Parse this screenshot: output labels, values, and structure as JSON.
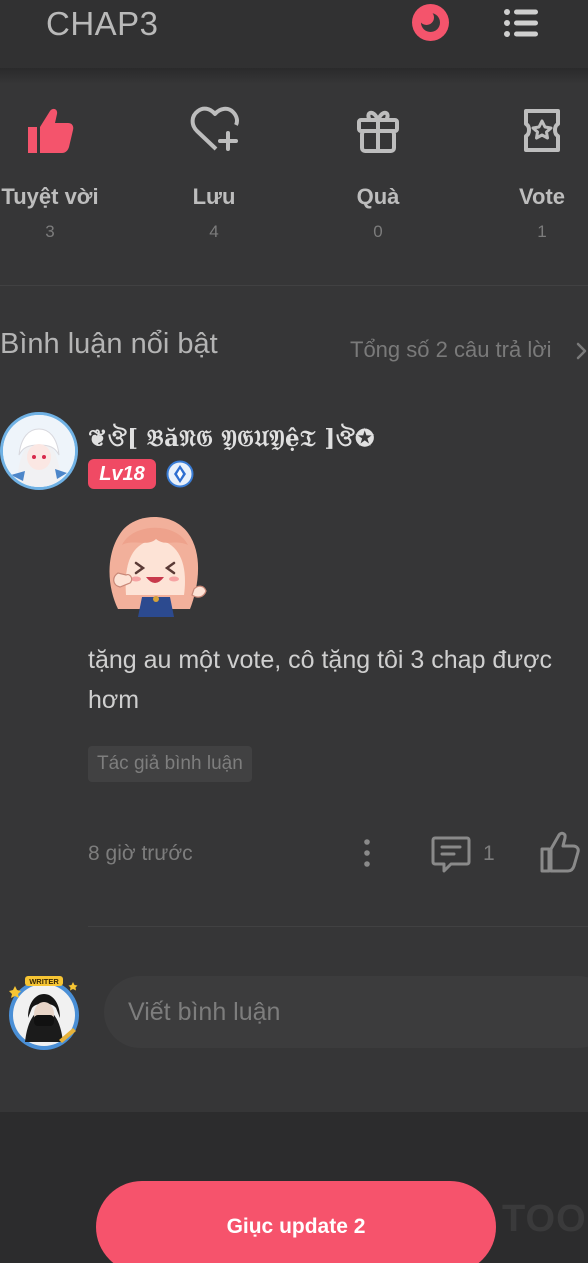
{
  "header": {
    "title": "CHAP3",
    "theme_icon": "moon-eye-icon",
    "menu_icon": "list-menu-icon"
  },
  "reactions": [
    {
      "label": "Tuyệt vời",
      "count": "3",
      "icon": "thumbs-up-icon",
      "color": "#f4546c"
    },
    {
      "label": "Lưu",
      "count": "4",
      "icon": "heart-plus-icon"
    },
    {
      "label": "Quà",
      "count": "0",
      "icon": "gift-icon"
    },
    {
      "label": "Vote",
      "count": "1",
      "icon": "star-ticket-icon"
    }
  ],
  "comments_section": {
    "title": "Bình luận nổi bật",
    "total": "Tổng số 2 câu trả lời"
  },
  "comment": {
    "username": "❦ঔ[ 𝔅ă𝔑𝔊 𝔜𝔊𝔘𝔜ệ𝔗 ]ঔ✪",
    "level": "Lv18",
    "text": "tặng au một vote, cô tặng tôi 3 chap được hơm",
    "tag": "Tác giả bình luận",
    "time": "8 giờ trước",
    "reply_count": "1"
  },
  "input": {
    "placeholder": "Viết bình luận",
    "avatar_badge": "WRITER"
  },
  "footer": {
    "button_label": "Giục update 2",
    "watermark": "TOO"
  },
  "colors": {
    "accent": "#f4546c",
    "background": "#363637"
  }
}
